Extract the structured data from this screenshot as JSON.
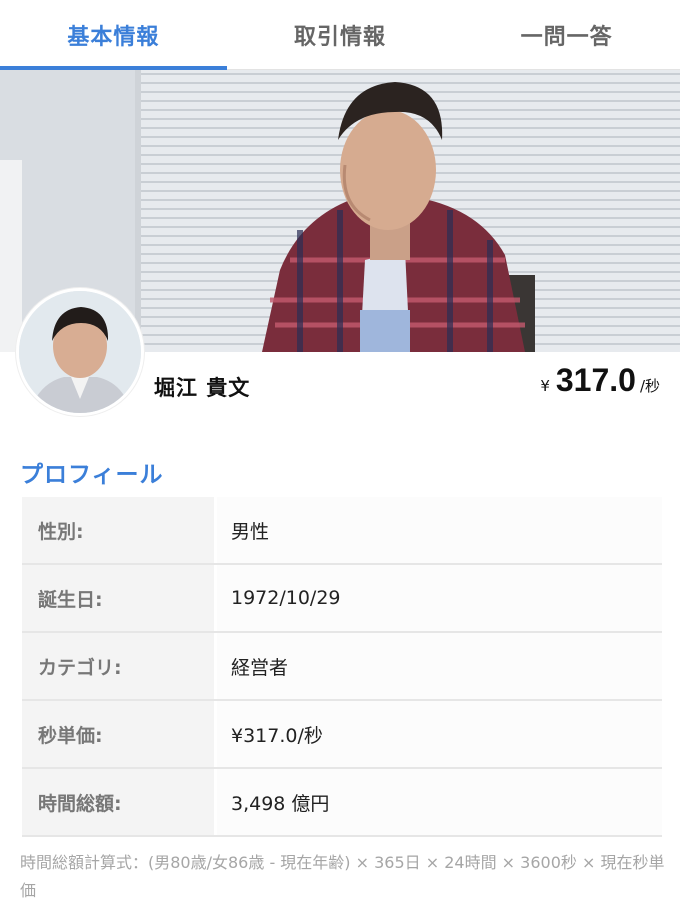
{
  "tabs": [
    {
      "label": "基本情報",
      "active": true
    },
    {
      "label": "取引情報",
      "active": false
    },
    {
      "label": "一問一答",
      "active": false
    }
  ],
  "profile": {
    "name": "堀江 貴文",
    "price": {
      "currency": "¥",
      "amount": "317.0",
      "unit": "/秒"
    }
  },
  "section": {
    "title": "プロフィール"
  },
  "rows": [
    {
      "label": "性別:",
      "value": "男性"
    },
    {
      "label": "誕生日:",
      "value": "1972/10/29"
    },
    {
      "label": "カテゴリ:",
      "value": "経営者"
    },
    {
      "label": "秒単価:",
      "value": "¥317.0/秒"
    },
    {
      "label": "時間総額:",
      "value": "3,498 億円"
    }
  ],
  "note": "時間総額計算式：(男80歳/女86歳 - 現在年齢) × 365日 × 24時間 × 3600秒 × 現在秒単価",
  "colors": {
    "accent": "#3b7fd9",
    "row_label_bg": "#f4f4f4"
  }
}
